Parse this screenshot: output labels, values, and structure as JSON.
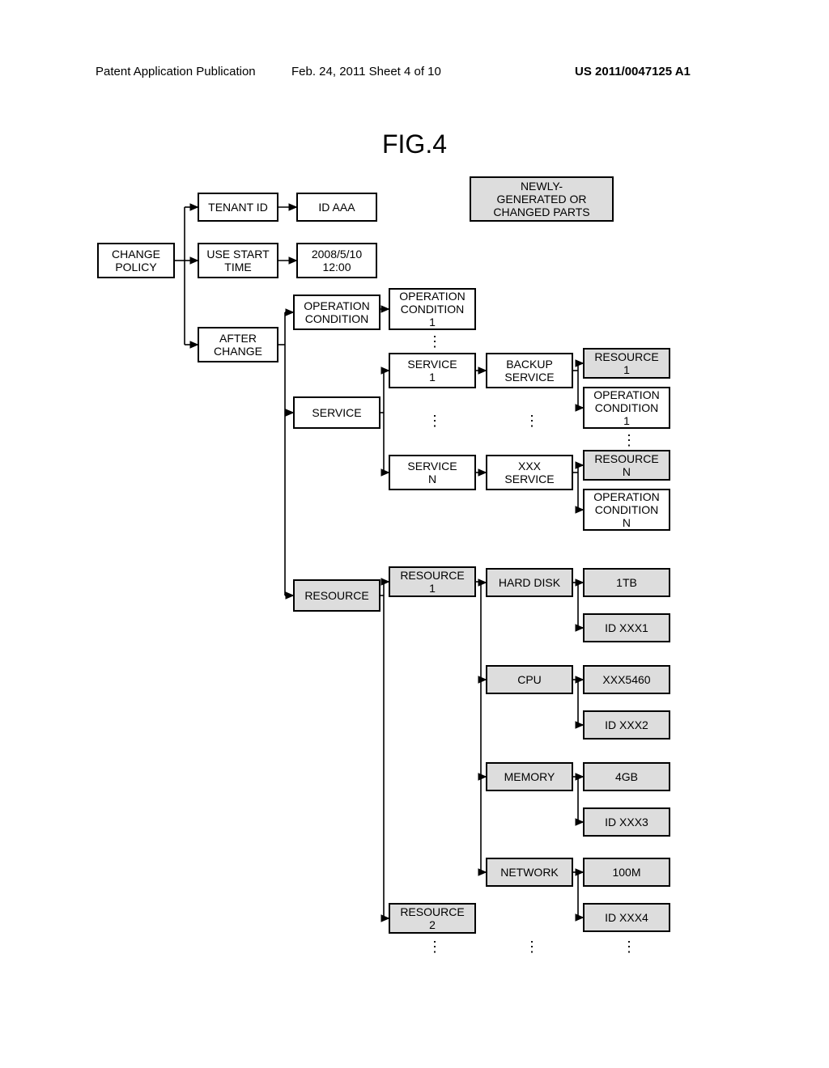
{
  "header": {
    "left": "Patent Application Publication",
    "mid": "Feb. 24, 2011   Sheet 4 of 10",
    "right": "US 2011/0047125 A1"
  },
  "fig_title": "FIG.4",
  "legend": "NEWLY-\nGENERATED OR\nCHANGED PARTS",
  "root": "CHANGE\nPOLICY",
  "tenant_id_label": "TENANT ID",
  "tenant_id_value": "ID AAA",
  "use_start_label": "USE START\nTIME",
  "use_start_value": "2008/5/10\n12:00",
  "after_change": "AFTER\nCHANGE",
  "op_cond_label": "OPERATION\nCONDITION",
  "op_cond_1": "OPERATION\nCONDITION\n1",
  "service_label": "SERVICE",
  "service_1": "SERVICE\n1",
  "service_n": "SERVICE\nN",
  "backup_service": "BACKUP\nSERVICE",
  "xxx_service": "XXX\nSERVICE",
  "resource_1_small": "RESOURCE\n1",
  "op_cond_1b": "OPERATION\nCONDITION\n1",
  "resource_n_small": "RESOURCE\nN",
  "op_cond_n": "OPERATION\nCONDITION\nN",
  "resource_label": "RESOURCE",
  "resource_1": "RESOURCE\n1",
  "resource_2": "RESOURCE\n2",
  "hard_disk": "HARD DISK",
  "hard_disk_val": "1TB",
  "hard_disk_id": "ID XXX1",
  "cpu": "CPU",
  "cpu_val": "XXX5460",
  "cpu_id": "ID XXX2",
  "memory": "MEMORY",
  "memory_val": "4GB",
  "memory_id": "ID XXX3",
  "network": "NETWORK",
  "network_val": "100M",
  "network_id": "ID XXX4",
  "vdots": "⋮"
}
